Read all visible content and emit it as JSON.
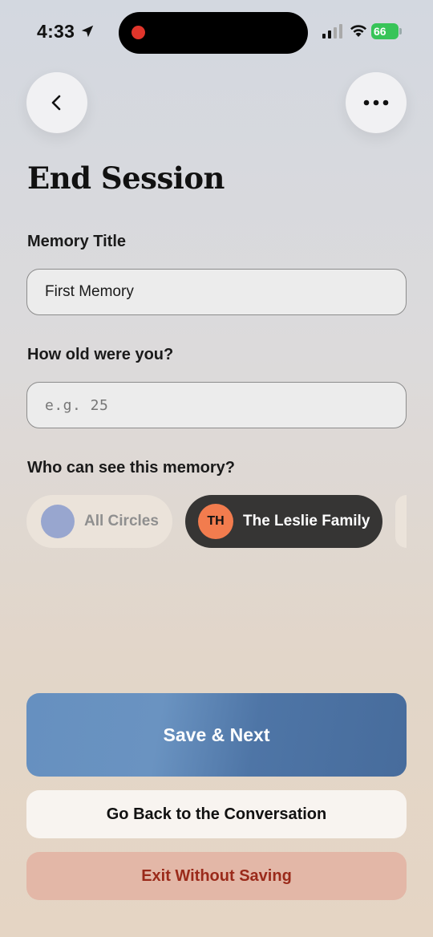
{
  "status": {
    "time": "4:33",
    "battery": "66"
  },
  "header": {
    "back_icon": "chevron-left-icon",
    "more_icon": "more-horizontal-icon"
  },
  "page": {
    "title": "End Session"
  },
  "form": {
    "memory_title_label": "Memory Title",
    "memory_title_value": "First Memory",
    "age_label": "How old were you?",
    "age_placeholder": "e.g. 25",
    "visibility_label": "Who can see this memory?"
  },
  "circles": [
    {
      "label": "All Circles",
      "selected": false,
      "color": "#98a6cf"
    },
    {
      "label": "The Leslie Family",
      "initials": "TH",
      "selected": true,
      "color": "#f27c4e"
    }
  ],
  "actions": {
    "save_label": "Save & Next",
    "back_label": "Go Back to the Conversation",
    "exit_label": "Exit Without Saving"
  },
  "colors": {
    "primary": "#5a82b3",
    "danger_text": "#9a2a1a",
    "danger_bg": "#e3b7a7",
    "selected_chip": "#363534"
  }
}
